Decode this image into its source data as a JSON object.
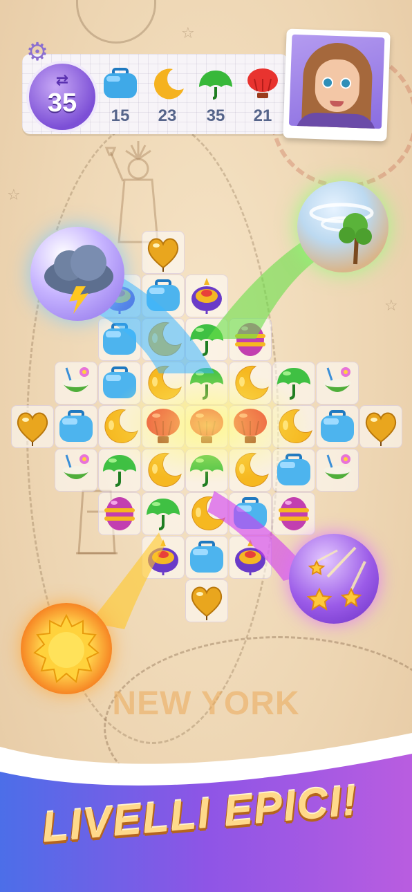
{
  "hud": {
    "settings_icon": "gear-icon",
    "moves": {
      "icon": "swap-arrows-icon",
      "value": "35"
    },
    "goals": [
      {
        "name": "blue-suitcase",
        "count": "15",
        "color": "#3fa9e8"
      },
      {
        "name": "yellow-moon",
        "count": "23",
        "color": "#f5b21f"
      },
      {
        "name": "green-umbrella",
        "count": "35",
        "color": "#38b83a"
      },
      {
        "name": "red-balloon",
        "count": "21",
        "color": "#e8332f"
      }
    ],
    "portrait": "girl-avatar"
  },
  "map": {
    "city": "NEW YORK"
  },
  "banner": {
    "text": "LIVELLI EPICI!"
  },
  "powerups": [
    {
      "name": "storm-cloud",
      "icon": "cloud-lightning-icon",
      "accent": "#3db7ff"
    },
    {
      "name": "tornado-tree",
      "icon": "tornado-icon",
      "accent": "#69e04a"
    },
    {
      "name": "meteor-shower",
      "icon": "shooting-stars-icon",
      "accent": "#d13bf0"
    },
    {
      "name": "sun",
      "icon": "sun-icon",
      "accent": "#ffb020"
    }
  ],
  "board": {
    "rows": [
      [
        null,
        null,
        null,
        "heart",
        null,
        null,
        null,
        null,
        null
      ],
      [
        null,
        null,
        "top",
        "suitcase",
        "top",
        null,
        null,
        null,
        null
      ],
      [
        null,
        null,
        "suitcase",
        "moon",
        "umbrella",
        "candy",
        null,
        null,
        null
      ],
      [
        null,
        "coconut",
        "suitcase",
        "moon",
        "umbrella",
        "moon",
        "umbrella",
        "coconut",
        null
      ],
      [
        "heart",
        "suitcase",
        "moon",
        "balloon",
        "balloon",
        "balloon",
        "moon",
        "suitcase",
        "heart"
      ],
      [
        null,
        "coconut",
        "umbrella",
        "moon",
        "umbrella",
        "moon",
        "suitcase",
        "coconut",
        null
      ],
      [
        null,
        null,
        "candy",
        "umbrella",
        "moon",
        "suitcase",
        "candy",
        null,
        null
      ],
      [
        null,
        null,
        null,
        "top",
        "suitcase",
        "top",
        null,
        null,
        null
      ],
      [
        null,
        null,
        null,
        null,
        "heart",
        null,
        null,
        null,
        null
      ]
    ]
  }
}
